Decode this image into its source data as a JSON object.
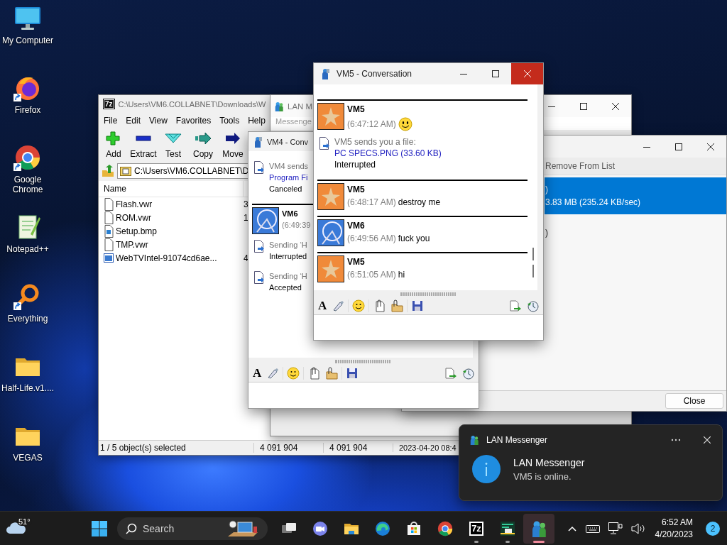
{
  "desktop_icons": [
    {
      "label": "My Computer",
      "kind": "monitor",
      "shortcut": false
    },
    {
      "label": "Firefox",
      "kind": "firefox",
      "shortcut": true
    },
    {
      "label": "Google Chrome",
      "kind": "chrome",
      "shortcut": true
    },
    {
      "label": "Notepad++",
      "kind": "notepad",
      "shortcut": false
    },
    {
      "label": "Everything",
      "kind": "everything",
      "shortcut": true
    },
    {
      "label": "Half-Life.v1....",
      "kind": "folder",
      "shortcut": false
    },
    {
      "label": "VEGAS",
      "kind": "folder",
      "shortcut": false
    }
  ],
  "archive_window": {
    "icon_label": "7z",
    "title": "C:\\Users\\VM6.COLLABNET\\Downloads\\W",
    "menu": [
      "File",
      "Edit",
      "View",
      "Favorites",
      "Tools",
      "Help"
    ],
    "toolbar": [
      {
        "label": "Add",
        "kind": "add"
      },
      {
        "label": "Extract",
        "kind": "extract"
      },
      {
        "label": "Test",
        "kind": "test"
      },
      {
        "label": "Copy",
        "kind": "copy"
      },
      {
        "label": "Move",
        "kind": "move"
      }
    ],
    "path": "C:\\Users\\VM6.COLLABNET\\D",
    "columns": [
      "Name"
    ],
    "files": [
      {
        "name": "Flash.vwr",
        "kind": "doc",
        "column_2": "3"
      },
      {
        "name": "ROM.vwr",
        "kind": "doc",
        "column_2": "1"
      },
      {
        "name": "Setup.bmp",
        "kind": "image"
      },
      {
        "name": "TMP.vwr",
        "kind": "doc"
      },
      {
        "name": "WebTVIntel-91074cd6ae...",
        "kind": "app",
        "column_2": "4"
      }
    ],
    "status": [
      "1 / 5 object(s) selected",
      "4 091 904",
      "4 091 904",
      "2023-04-20 08:4"
    ]
  },
  "messenger_window": {
    "title": "LAN M",
    "label": "Messenge"
  },
  "transfer_window": {
    "toolbar": [
      "Remove From List"
    ],
    "transfers": [
      {
        "line_1": ")",
        "line_2": "3.83 MB (235.24 KB/sec)",
        "selected": true
      },
      {
        "line_1": ")",
        "selected": false
      }
    ],
    "close_button": "Close"
  },
  "vm4_conversation": {
    "title": "VM4 - Conv",
    "font_button": "A",
    "entries": [
      {
        "kind": "file",
        "caption": "VM4 sends",
        "link": "Program Fi",
        "status": "Canceled"
      },
      {
        "kind": "message",
        "sender": "VM6",
        "avatar": {
          "kind": "ferris-wheel"
        },
        "time": "(6:49:39",
        "emoticon": false
      },
      {
        "kind": "file",
        "caption": "Sending ‘H",
        "status": "Interrupted"
      },
      {
        "kind": "file",
        "caption": "Sending ‘H",
        "status": "Accepted"
      }
    ]
  },
  "vm5_conversation": {
    "title": "VM5 - Conversation",
    "close_hovered": true,
    "font_button": "A",
    "entries": [
      {
        "kind": "message",
        "sender": "VM5",
        "avatar": {
          "kind": "starfish"
        },
        "time": "(6:47:12 AM)",
        "emoticon": true
      },
      {
        "kind": "file",
        "caption": "VM5 sends you a file:",
        "link": "PC SPECS.PNG (33.60 KB)",
        "status": "Interrupted"
      },
      {
        "kind": "message",
        "sender": "VM5",
        "avatar": {
          "kind": "starfish"
        },
        "time": "(6:48:17 AM)",
        "text": "destroy me",
        "emoticon": false
      },
      {
        "kind": "message",
        "sender": "VM6",
        "avatar": {
          "kind": "ferris-wheel"
        },
        "time": "(6:49:56 AM)",
        "text": "fuck you",
        "emoticon": false
      },
      {
        "kind": "message",
        "sender": "VM5",
        "avatar": {
          "kind": "starfish"
        },
        "time": "(6:51:05 AM)",
        "text": "hi",
        "emoticon": false
      }
    ]
  },
  "notification": {
    "app": "LAN Messenger",
    "title": "LAN Messenger",
    "body": "VM5 is online."
  },
  "taskbar": {
    "weather": "51°",
    "search": {
      "placeholder": "Search"
    },
    "apps": [
      {
        "kind": "task-view",
        "running": false,
        "active": false
      },
      {
        "kind": "chat",
        "running": false,
        "active": false
      },
      {
        "kind": "explorer",
        "running": false,
        "active": false
      },
      {
        "kind": "edge",
        "running": false,
        "active": false
      },
      {
        "kind": "store",
        "running": false,
        "active": false
      },
      {
        "kind": "chrome",
        "running": false,
        "active": false
      },
      {
        "kind": "archiver",
        "label": "7z",
        "running": true,
        "active": false
      },
      {
        "kind": "irc",
        "running": true,
        "active": false
      },
      {
        "kind": "messenger",
        "running": true,
        "active": true
      }
    ],
    "time": "6:52 AM",
    "date": "4/20/2023",
    "badge": "2"
  }
}
